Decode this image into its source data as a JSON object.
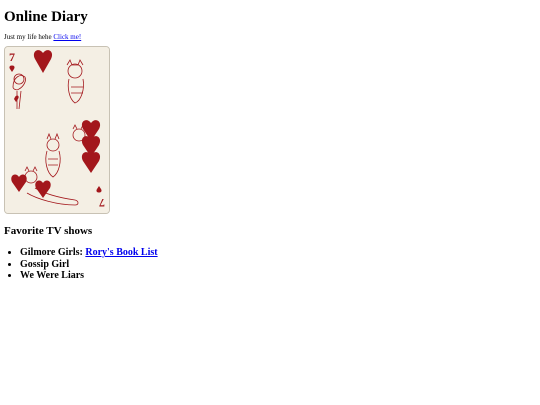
{
  "header": {
    "title": "Online Diary"
  },
  "tagline": {
    "text": "Just my life hehe",
    "link_label": "Click me!"
  },
  "card": {
    "rank": "7",
    "suit": "hearts",
    "theme_colors": {
      "red": "#a3171c",
      "paper": "#f4efe4"
    }
  },
  "favorites": {
    "heading": "Favorite TV shows",
    "items": [
      {
        "label": "Gilmore Girls: ",
        "link": "Rory's Book List"
      },
      {
        "label": "Gossip Girl"
      },
      {
        "label": "We Were Liars"
      }
    ]
  }
}
